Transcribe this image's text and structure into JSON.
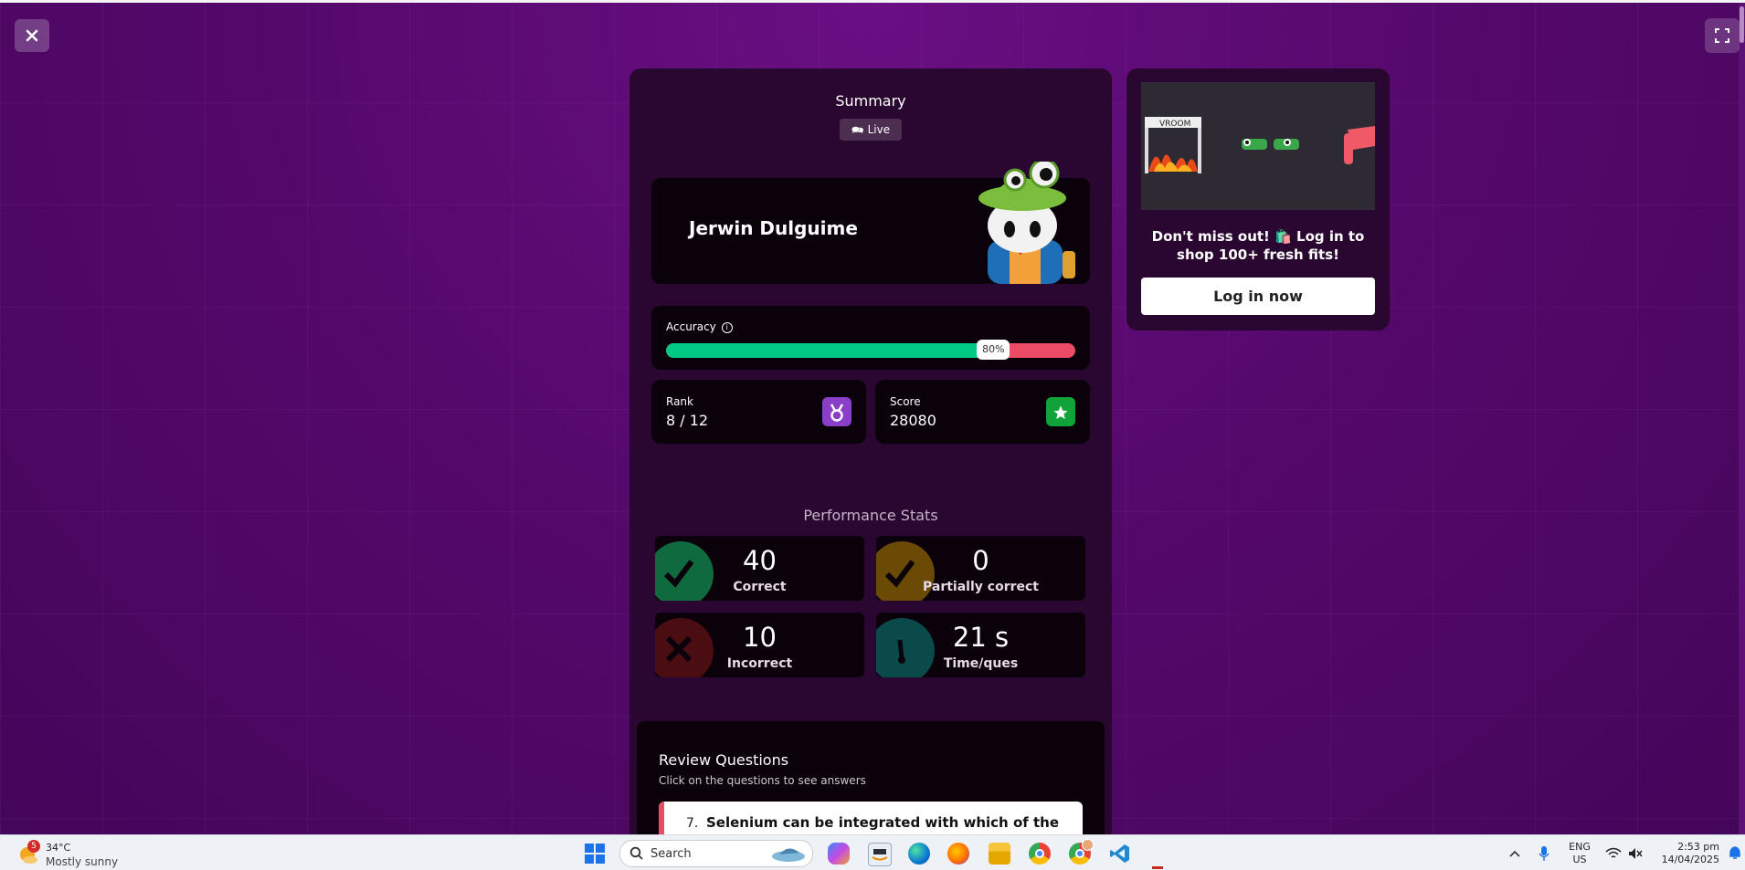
{
  "summary": {
    "title": "Summary",
    "live_label": "Live"
  },
  "player": {
    "name": "Jerwin Dulguime"
  },
  "accuracy": {
    "label": "Accuracy",
    "percent": 80,
    "percent_label": "80%"
  },
  "rank": {
    "label": "Rank",
    "value": "8 / 12"
  },
  "score": {
    "label": "Score",
    "value": "28080"
  },
  "performance": {
    "title": "Performance Stats",
    "stats": [
      {
        "value": "40",
        "label": "Correct",
        "color": "#0f6b3f",
        "icon": "check-icon"
      },
      {
        "value": "0",
        "label": "Partially correct",
        "color": "#6b4a06",
        "icon": "check-icon"
      },
      {
        "value": "10",
        "label": "Incorrect",
        "color": "#4a0d12",
        "icon": "cross-icon"
      },
      {
        "value": "21 s",
        "label": "Time/ques",
        "color": "#0b4a4a",
        "icon": "stopwatch-icon"
      }
    ]
  },
  "review": {
    "title": "Review Questions",
    "subtitle": "Click on the questions to see answers",
    "question_number": "7.",
    "question_text": "Selenium can be integrated with which of the"
  },
  "ad": {
    "text": "Don't miss out! 🛍️ Log in to shop 100+ fresh fits!",
    "button_label": "Log in now",
    "banner_text": "VROOM"
  },
  "taskbar": {
    "weather_temp": "34°C",
    "weather_condition": "Mostly sunny",
    "weather_badge": "5",
    "search_label": "Search",
    "language_line1": "ENG",
    "language_line2": "US",
    "time": "2:53 pm",
    "date": "14/04/2025"
  },
  "colors": {
    "accent_green": "#00c985",
    "accent_red": "#ec4b66",
    "rank_purple": "#8b3fc8",
    "score_green": "#0fa33a"
  }
}
